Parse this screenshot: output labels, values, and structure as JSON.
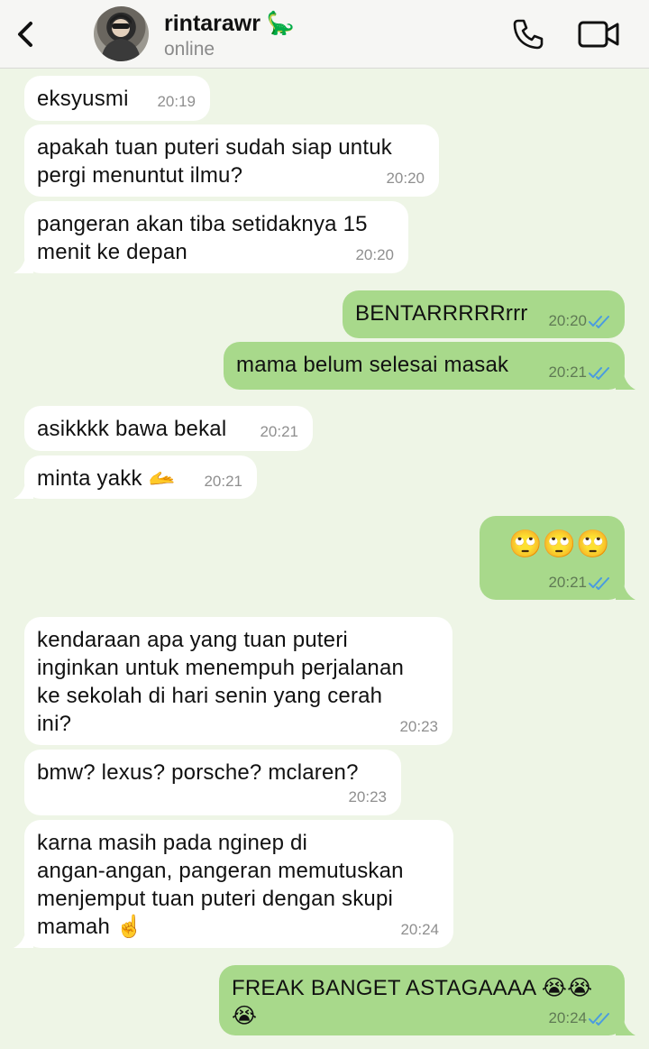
{
  "header": {
    "contact_name": "rintarawr 🦕",
    "status": "online"
  },
  "colors": {
    "chat_background": "#eef5e6",
    "incoming_bubble": "#ffffff",
    "outgoing_bubble": "#a8d98b",
    "read_ticks": "#4a9be0"
  },
  "messages": [
    {
      "direction": "in",
      "text": "eksyusmi",
      "time": "20:19"
    },
    {
      "direction": "in",
      "text": "apakah tuan puteri sudah siap untuk\npergi menuntut ilmu?",
      "time": "20:20"
    },
    {
      "direction": "in",
      "text": "pangeran akan tiba setidaknya 15\nmenit ke depan",
      "time": "20:20"
    },
    {
      "direction": "out",
      "text": "BENTARRRRRrrr",
      "time": "20:20",
      "status": "read"
    },
    {
      "direction": "out",
      "text": "mama belum selesai masak",
      "time": "20:21",
      "status": "read"
    },
    {
      "direction": "in",
      "text": "asikkkk bawa bekal",
      "time": "20:21"
    },
    {
      "direction": "in",
      "text": "minta yakk 🫴",
      "time": "20:21"
    },
    {
      "direction": "out",
      "text": "🙄🙄🙄",
      "time": "20:21",
      "status": "read"
    },
    {
      "direction": "in",
      "text": "kendaraan apa yang tuan puteri\ninginkan untuk menempuh perjalanan\nke sekolah di hari senin yang cerah\nini?",
      "time": "20:23"
    },
    {
      "direction": "in",
      "text": "bmw? lexus? porsche? mclaren?",
      "time": "20:23"
    },
    {
      "direction": "in",
      "text": "karna masih pada nginep di\nangan-angan, pangeran memutuskan\nmenjemput tuan puteri dengan skupi\nmamah ☝️",
      "time": "20:24"
    },
    {
      "direction": "out",
      "text": "FREAK BANGET ASTAGAAAA 😭😭\n😭",
      "time": "20:24",
      "status": "read"
    }
  ]
}
